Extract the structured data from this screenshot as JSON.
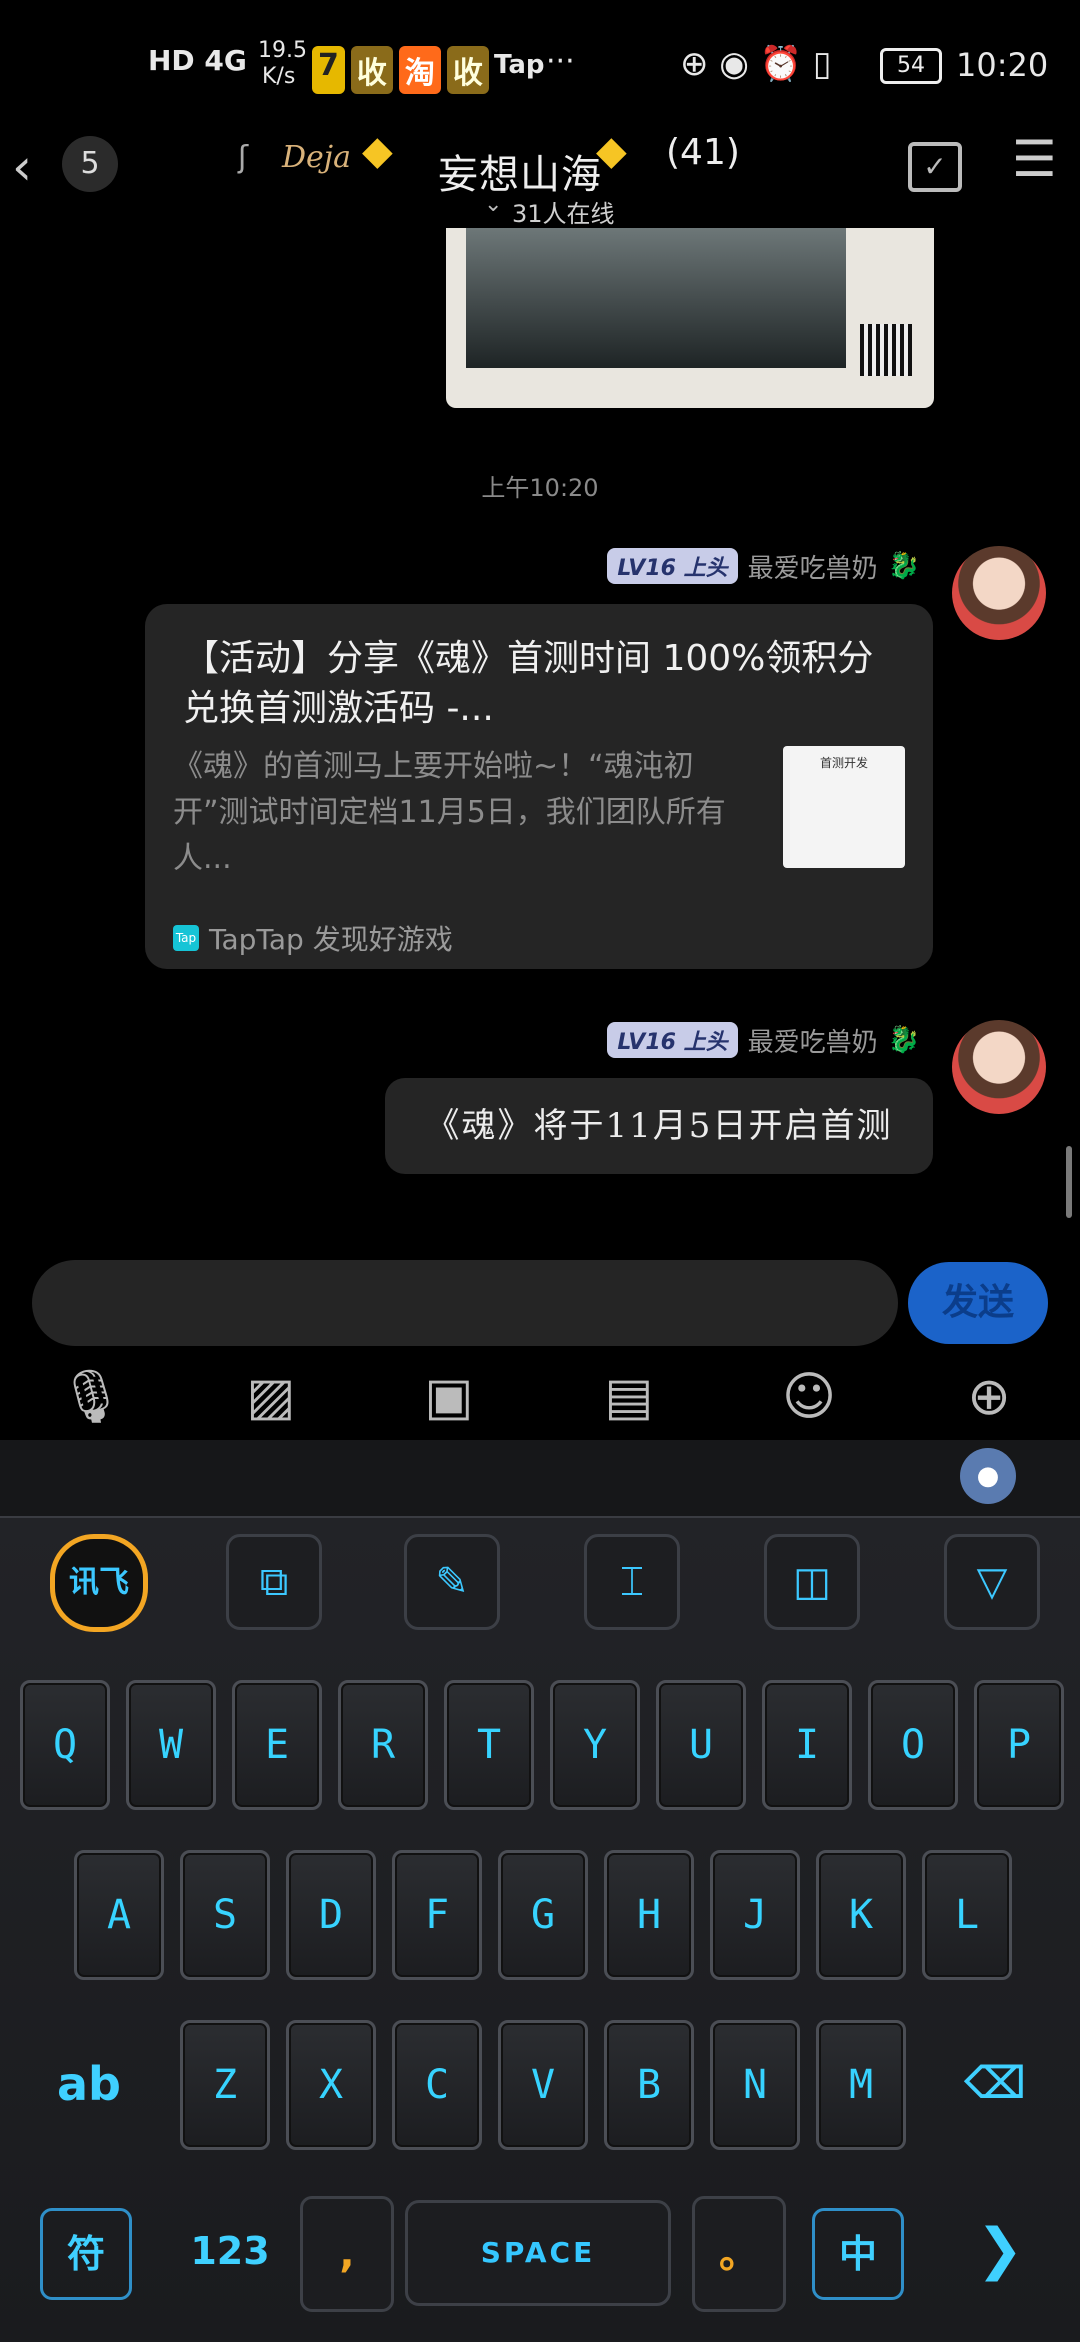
{
  "status_bar": {
    "network": "HD 4G",
    "speed_value": "19.5",
    "speed_unit": "K/s",
    "app_badges": [
      "7",
      "收",
      "淘",
      "收"
    ],
    "tap": "Tap",
    "more": "···",
    "battery": "54",
    "time": "10:20"
  },
  "header": {
    "back_count": "5",
    "deja": "Deja",
    "title": "妄想山海",
    "member_count": "(41)",
    "online": "31人在线"
  },
  "chat": {
    "timestamp": "上午10:20",
    "messages": [
      {
        "level": "LV16 上头",
        "nickname": "最爱吃兽奶",
        "card": {
          "title": "【活动】分享《魂》首测时间 100%领积分兑换首测激活码 -...",
          "description": "《魂》的首测马上要开始啦~！“魂沌初开”测试时间定档11月5日，我们团队所有人...",
          "source": "TapTap 发现好游戏",
          "thumb_caption": "首测开发"
        }
      },
      {
        "level": "LV16 上头",
        "nickname": "最爱吃兽奶",
        "text": "《魂》将于11月5日开启首测"
      }
    ]
  },
  "input": {
    "placeholder": "",
    "send_label": "发送"
  },
  "toolbar": [
    "mic-icon",
    "image-icon",
    "camera-icon",
    "file-icon",
    "emoji-icon",
    "plus-icon"
  ],
  "keyboard": {
    "row1": [
      "Q",
      "W",
      "E",
      "R",
      "T",
      "Y",
      "U",
      "I",
      "O",
      "P"
    ],
    "row2": [
      "A",
      "S",
      "D",
      "F",
      "G",
      "H",
      "J",
      "K",
      "L"
    ],
    "row3": [
      "Z",
      "X",
      "C",
      "V",
      "B",
      "N",
      "M"
    ],
    "logo": "讯飞",
    "case_key": "ab",
    "symbol_key": "符",
    "number_key": "123",
    "comma": ",",
    "space": "SPACE",
    "period": "。",
    "lang_key": "中",
    "colors": {
      "key_text": "#37d3ff",
      "key_bg": "#1c1d20",
      "send_bg": "#1b63c9"
    }
  }
}
